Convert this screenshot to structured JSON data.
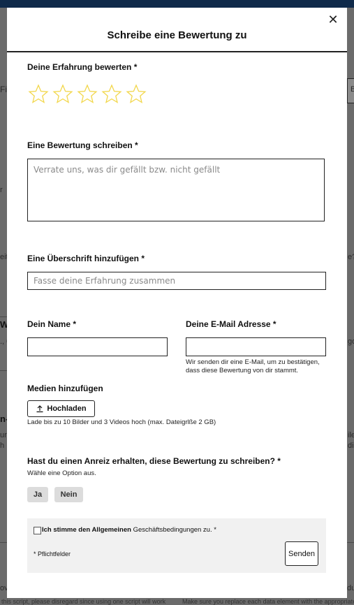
{
  "background": {
    "frag_left_1": "Fi",
    "frag_left_2": "r",
    "frag_left_3": "eit",
    "frag_left_4": "W",
    "frag_left_5": "., 0",
    "frag_left_6": "n-",
    "frag_left_7": "ur",
    "frag_left_8": "h K",
    "frag_left_9": "ov",
    "frag_right_1": "B",
    "frag_right_2": "e?",
    "frag_right_3": "go",
    "frag_right_4": "ile",
    "frag_right_5": "dic",
    "frag_right_6": "du",
    "bottom_text_1": "this script, please disregard since using one script will work",
    "bottom_text_2": "Make sure you replace each data element with the appropriate"
  },
  "modal": {
    "title": "Schreibe eine Bewertung zu",
    "close_symbol": "✕",
    "rating": {
      "label": "Deine Erfahrung bewerten *",
      "star_count": 5,
      "selected": 0,
      "star_color": "#f2d74c"
    },
    "review": {
      "label": "Eine Bewertung schreiben *",
      "placeholder": "Verrate uns, was dir gefällt bzw. nicht gefällt",
      "value": ""
    },
    "headline": {
      "label": "Eine Überschrift hinzufügen *",
      "placeholder": "Fasse deine Erfahrung zusammen",
      "value": ""
    },
    "name": {
      "label": "Dein Name *",
      "value": ""
    },
    "email": {
      "label": "Deine E-Mail Adresse *",
      "value": "",
      "hint_line1": "Wir senden dir eine E-Mail, um zu bestätigen,",
      "hint_line2": "dass diese Bewertung von dir stammt."
    },
    "media": {
      "label": "Medien hinzufügen",
      "upload_label": "Hochladen",
      "hint": "Lade bis zu 10 Bilder und 3 Videos hoch (max. Dateigrlße 2 GB)"
    },
    "incentive": {
      "label": "Hast du einen Anreiz erhalten, diese Bewertung zu schreiben? *",
      "hint": "Wähle eine Option aus.",
      "option_yes": "Ja",
      "option_no": "Nein"
    },
    "footer": {
      "consent_bold": "Ich stimme den Allgemeinen",
      "consent_rest": " Geschäftsbedingungen zu. *",
      "required_note": "* Pflichtfelder",
      "submit_label": "Senden"
    }
  }
}
